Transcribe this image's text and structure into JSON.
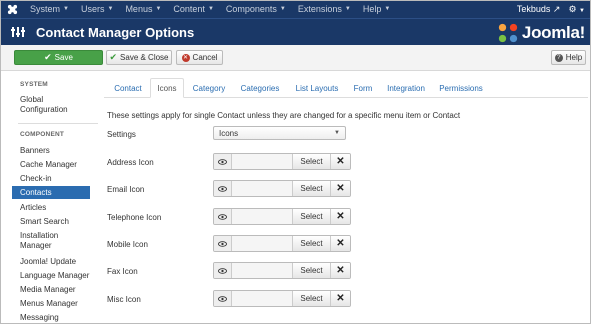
{
  "topnav": {
    "items": [
      "System",
      "Users",
      "Menus",
      "Content",
      "Components",
      "Extensions",
      "Help"
    ],
    "user": "Tekbuds"
  },
  "header": {
    "title": "Contact Manager Options",
    "brand": "Joomla!",
    "brand_colors": [
      "#f9a541",
      "#f44321",
      "#5091cd",
      "#7ac143"
    ]
  },
  "toolbar": {
    "save_label": "Save",
    "save_close_label": "Save & Close",
    "cancel_label": "Cancel",
    "help_label": "Help"
  },
  "sidebar": {
    "system_heading": "SYSTEM",
    "global_config_line1": "Global",
    "global_config_line2": "Configuration",
    "component_heading": "COMPONENT",
    "items": [
      "Banners",
      "Cache Manager",
      "Check-in",
      "Contacts",
      "Articles",
      "Smart Search",
      "Installation",
      "Manager",
      "Joomla! Update",
      "Language Manager",
      "Media Manager",
      "Menus Manager",
      "Messaging"
    ],
    "active_item": "Contacts"
  },
  "tabs": [
    "Contact",
    "Icons",
    "Category",
    "Categories",
    "List Layouts",
    "Form",
    "Integration",
    "Permissions"
  ],
  "active_tab": "Icons",
  "content": {
    "description": "These settings apply for single Contact unless they are changed for a specific menu item or Contact",
    "settings_label": "Settings",
    "settings_value": "Icons",
    "select_label": "Select",
    "icon_rows": [
      "Address Icon",
      "Email Icon",
      "Telephone Icon",
      "Mobile Icon",
      "Fax Icon",
      "Misc Icon"
    ]
  }
}
